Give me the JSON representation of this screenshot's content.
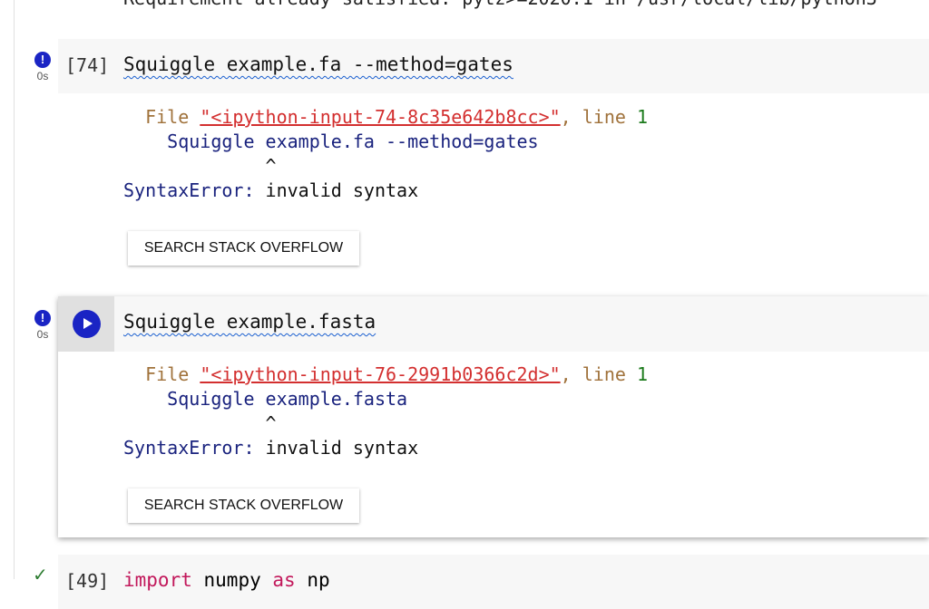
{
  "previous_output": "Requirement already satisfied: pytz>=2020.1 in /usr/local/lib/python3",
  "cells": [
    {
      "exec_count": "[74]",
      "code": "Squiggle example.fa --method=gates",
      "status_icon": "error-icon",
      "time": "0s",
      "output": {
        "file_label": "File",
        "file_link": "\"<ipython-input-74-8c35e642b8cc>\"",
        "line_label": ", line",
        "line_num": "1",
        "code_line": "Squiggle example.fa --method=gates",
        "caret": "^",
        "error_type": "SyntaxError:",
        "error_msg": "invalid syntax"
      },
      "button": "SEARCH STACK OVERFLOW"
    },
    {
      "exec_count": "",
      "code": "Squiggle example.fasta",
      "status_icon": "error-icon",
      "time": "0s",
      "output": {
        "file_label": "File",
        "file_link": "\"<ipython-input-76-2991b0366c2d>\"",
        "line_label": ", line",
        "line_num": "1",
        "code_line": "Squiggle example.fasta",
        "caret": "^",
        "error_type": "SyntaxError:",
        "error_msg": "invalid syntax"
      },
      "button": "SEARCH STACK OVERFLOW"
    },
    {
      "exec_count": "[49]",
      "code_keyword": "import",
      "code_module": "numpy",
      "code_as": "as",
      "code_alias": "np",
      "status_icon": "check-icon"
    }
  ]
}
